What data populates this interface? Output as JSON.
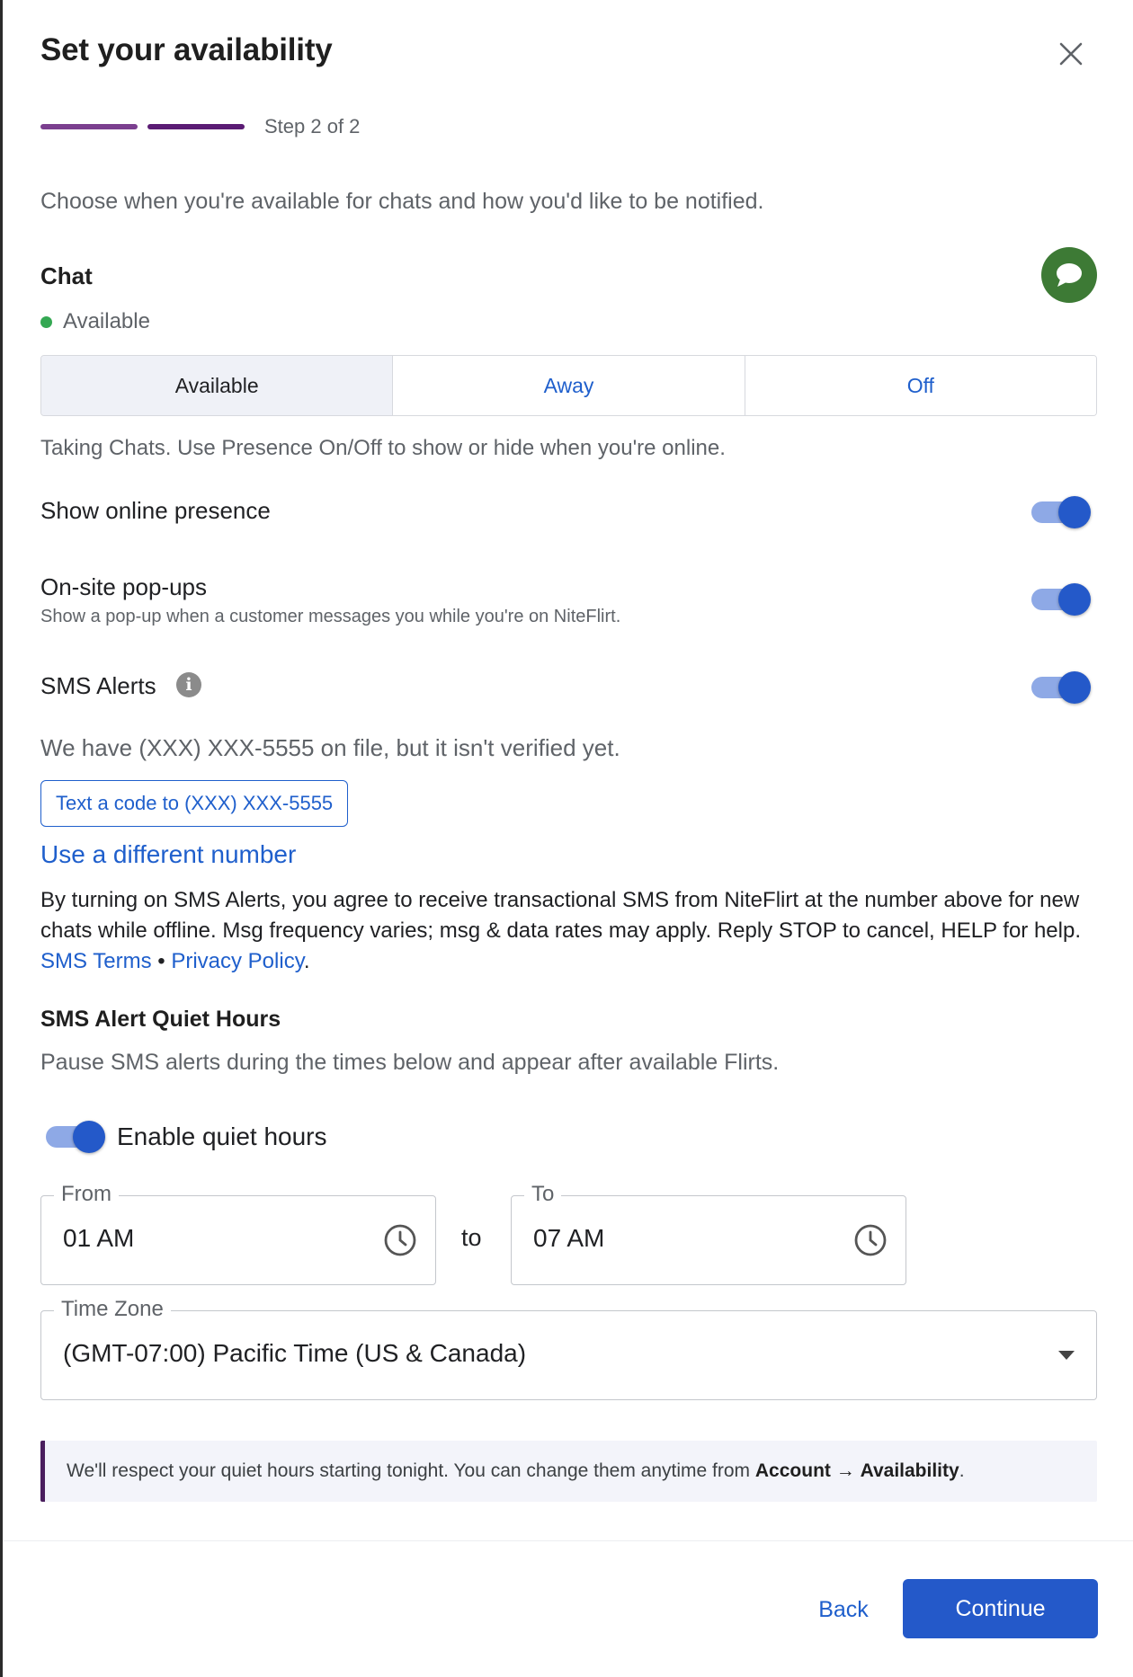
{
  "dialog": {
    "title": "Set your availability",
    "close_icon": "close-icon"
  },
  "steps": {
    "label": "Step 2 of 2",
    "current": 2,
    "total": 2,
    "colors": [
      "#7b3f8f",
      "#5b1c74"
    ]
  },
  "intro": "Choose when you're available for chats and how you'd like to be notified.",
  "chat": {
    "title": "Chat",
    "icon": "chat-bubble-icon",
    "status_label": "Available",
    "status_color": "#34a853",
    "segments": [
      {
        "label": "Available",
        "selected": true
      },
      {
        "label": "Away",
        "selected": false
      },
      {
        "label": "Off",
        "selected": false
      }
    ],
    "description": "Taking Chats. Use Presence On/Off to show or hide when you're online."
  },
  "settings": {
    "show_online_presence": {
      "label": "Show online presence",
      "enabled": true
    },
    "onsite_popups": {
      "label": "On-site pop-ups",
      "description": "Show a pop-up when a customer messages you while you're on NiteFlirt.",
      "enabled": true
    },
    "sms_alerts": {
      "label": "SMS Alerts",
      "info_icon": "info-icon",
      "enabled": true
    }
  },
  "sms": {
    "file_notice": "We have (XXX) XXX-5555 on file, but it isn't verified yet.",
    "text_code_button": "Text a code to (XXX) XXX-5555",
    "different_number_link": "Use a different number",
    "legal_text": "By turning on SMS Alerts, you agree to receive transactional SMS from NiteFlirt at the number above for new chats while offline. Msg frequency varies; msg & data rates may apply. Reply STOP to cancel, HELP for help.",
    "terms_link": "SMS Terms",
    "separator": "•",
    "privacy_link": "Privacy Policy",
    "end_punct": "."
  },
  "quiet_hours": {
    "title": "SMS Alert Quiet Hours",
    "description": "Pause SMS alerts during the times below and appear after available Flirts.",
    "enable_label": "Enable quiet hours",
    "enabled": true,
    "from_label": "From",
    "from_value": "01 AM",
    "to_word": "to",
    "to_label": "To",
    "to_value": "07 AM",
    "clock_icon": "clock-icon",
    "timezone_label": "Time Zone",
    "timezone_value": "(GMT-07:00) Pacific Time (US & Canada)"
  },
  "callout": {
    "text": "We'll respect your quiet hours starting tonight. You can change them anytime from",
    "path_start": "Account",
    "arrow": "→",
    "path_end": "Availability",
    "end_punct": "."
  },
  "footer": {
    "back_label": "Back",
    "continue_label": "Continue"
  },
  "colors": {
    "accent_blue": "#2459c9",
    "link_blue": "#1f5fcc",
    "chat_green": "#3d7a35",
    "callout_border": "#4a1e5e"
  }
}
